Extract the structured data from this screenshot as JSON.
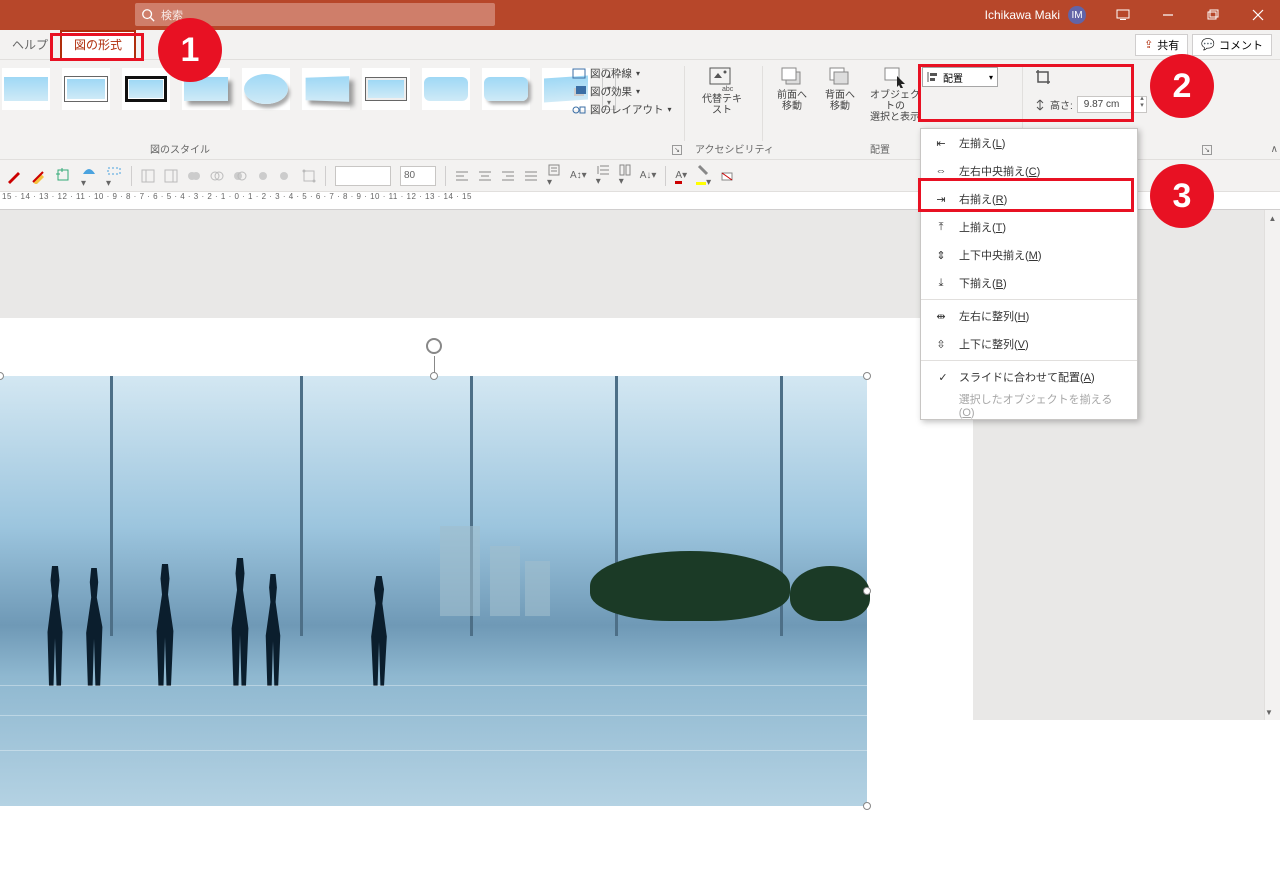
{
  "titlebar": {
    "search_placeholder": "検索",
    "user_name": "Ichikawa Maki",
    "user_initials": "IM"
  },
  "tabs": {
    "help": "ヘルプ",
    "picture_format": "図の形式"
  },
  "share": {
    "share": "共有",
    "comment": "コメント"
  },
  "ribbon": {
    "border": "図の枠線",
    "effects": "図の効果",
    "layout": "図のレイアウト",
    "alt_text": "代替テキスト",
    "bring_forward": "前面へ\n移動",
    "send_backward": "背面へ\n移動",
    "selection_pane": "オブジェクトの\n選択と表示",
    "align": "配置",
    "height_label": "高さ:",
    "height_value": "9.87 cm",
    "grp_style": "図のスタイル",
    "grp_acc": "アクセシビリティ",
    "grp_arrange": "配置"
  },
  "toolbar2": {
    "font_size": "80"
  },
  "ruler": "15 · 14 · 13 · 12 · 11 · 10 · 9 · 8 · 7 · 6 · 5 · 4 · 3 · 2 · 1 · 0 · 1 · 2 · 3 · 4 · 5 · 6 · 7 · 8 · 9 · 10 · 11 · 12 · 13 · 14 · 15",
  "dropdown": {
    "items": [
      {
        "label": "左揃え(",
        "key": "L",
        "suffix": ")"
      },
      {
        "label": "左右中央揃え(",
        "key": "C",
        "suffix": ")"
      },
      {
        "label": "右揃え(",
        "key": "R",
        "suffix": ")"
      },
      {
        "label": "上揃え(",
        "key": "T",
        "suffix": ")"
      },
      {
        "label": "上下中央揃え(",
        "key": "M",
        "suffix": ")"
      },
      {
        "label": "下揃え(",
        "key": "B",
        "suffix": ")"
      },
      {
        "label": "左右に整列(",
        "key": "H",
        "suffix": ")"
      },
      {
        "label": "上下に整列(",
        "key": "V",
        "suffix": ")"
      },
      {
        "label": "スライドに合わせて配置(",
        "key": "A",
        "suffix": ")"
      },
      {
        "label": "選択したオブジェクトを揃える(",
        "key": "O",
        "suffix": ")"
      }
    ]
  },
  "annotations": {
    "one": "1",
    "two": "2",
    "three": "3"
  }
}
